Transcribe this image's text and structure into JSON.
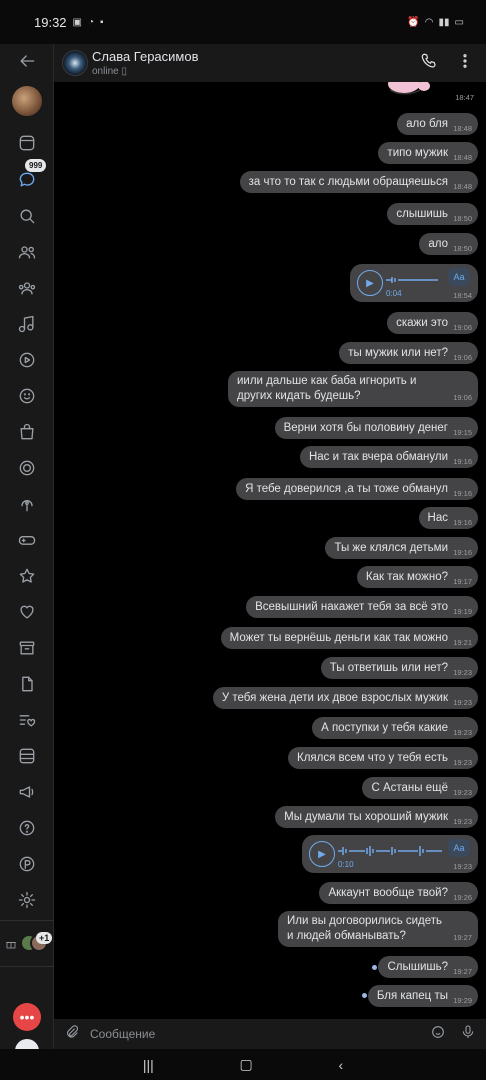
{
  "status_bar": {
    "time": "19:32",
    "battery": ""
  },
  "sidebar": {
    "badge_count": "999",
    "plus_count": "+1"
  },
  "header": {
    "name": "Слава Герасимов",
    "status": "online"
  },
  "composer": {
    "placeholder": "Сообщение"
  },
  "sticker_time": "18:47",
  "messages": [
    {
      "text": "ало бля",
      "time": "18:48"
    },
    {
      "text": "типо мужик",
      "time": "18:48"
    },
    {
      "text": "за что то так с людьми обращяешься",
      "time": "18:48"
    },
    {
      "text": "слышишь",
      "time": "18:50"
    },
    {
      "text": "ало",
      "time": "18:50"
    },
    {
      "voice_duration": "0:04",
      "time": "18:54",
      "aa": "Аа"
    },
    {
      "text": "скажи это",
      "time": "19:06"
    },
    {
      "text": "ты мужик или нет?",
      "time": "19:06"
    },
    {
      "text": "иили дальше как баба игнорить и других кидать будешь?",
      "time": "19:06"
    },
    {
      "text": "Верни хотя бы половину денег",
      "time": "19:15"
    },
    {
      "text": "Нас и так вчера обманули",
      "time": "19:16"
    },
    {
      "text": "Я тебе доверился ,а ты тоже обманул",
      "time": "19:16"
    },
    {
      "text": "Нас",
      "time": "19:16"
    },
    {
      "text": "Ты же клялся детьми",
      "time": "19:16"
    },
    {
      "text": "Как так можно?",
      "time": "19:17"
    },
    {
      "text": "Всевышний накажет тебя за всё это",
      "time": "19:19"
    },
    {
      "text": "Может ты вернёшь деньги как так можно",
      "time": "19:21"
    },
    {
      "text": "Ты ответишь или нет?",
      "time": "19:23"
    },
    {
      "text": "У тебя жена дети их двое взрослых мужик",
      "time": "19:23"
    },
    {
      "text": "А поступки у тебя какие",
      "time": "19:23"
    },
    {
      "text": "Клялся всем что у тебя есть",
      "time": "19:23"
    },
    {
      "text": "С Астаны ещё",
      "time": "19:23"
    },
    {
      "text": "Мы думали ты хороший мужик",
      "time": "19:23"
    },
    {
      "voice_duration": "0:10",
      "time": "19:23",
      "aa": "Аа"
    },
    {
      "text": "Аккаунт вообще твой?",
      "time": "19:26"
    },
    {
      "text": "Или вы договорились сидеть и людей обманывать?",
      "time": "19:27"
    },
    {
      "text": "Слышишь?",
      "time": "19:27"
    },
    {
      "text": "Бля капец ты",
      "time": "19:29"
    }
  ],
  "colors": {
    "accent": "#71aaeb",
    "bubble": "#444446",
    "background": "#000000",
    "panel": "#19191a",
    "red": "#e64646"
  },
  "icons": [
    "back-arrow-icon",
    "phone-icon",
    "more-vertical-icon",
    "attach-icon",
    "emoji-icon",
    "mic-icon"
  ]
}
